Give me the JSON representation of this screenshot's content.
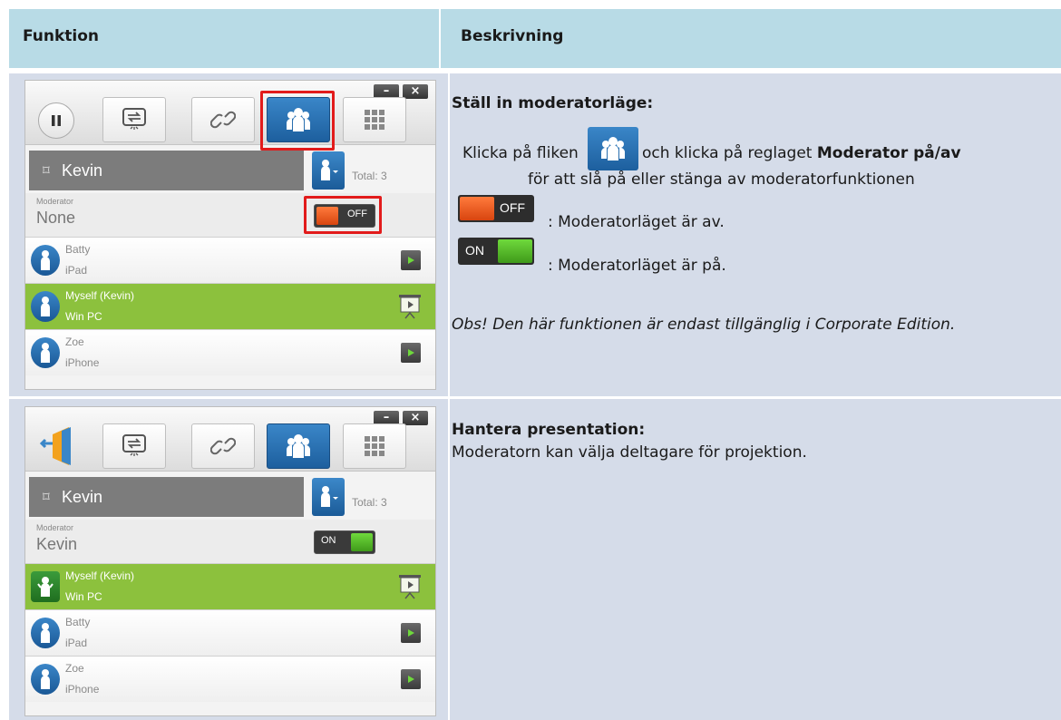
{
  "header": {
    "col1": "Funktion",
    "col2": "Beskrivning"
  },
  "row1": {
    "title": "Ställ in moderatorläge:",
    "line1_pre": "Klicka på fliken",
    "line1_mid": " och klicka på reglaget ",
    "line1_bold": "Moderator på/av",
    "line2": "för att slå på eller stänga av moderatorfunktionen",
    "off_desc": ": Moderatorläget är av.",
    "on_desc": ": Moderatorläget är på.",
    "note": "Obs! Den här funktionen är endast tillgänglig i Corporate Edition.",
    "panel": {
      "name": "Kevin",
      "total": "Total: 3",
      "moderator_label": "Moderator",
      "moderator_value": "None",
      "toggle_text": "OFF",
      "users": [
        {
          "name": "Batty",
          "device": "iPad"
        },
        {
          "name": "Myself (Kevin)",
          "device": "Win PC"
        },
        {
          "name": "Zoe",
          "device": "iPhone"
        }
      ]
    }
  },
  "row2": {
    "title": "Hantera presentation:",
    "text": "Moderatorn kan välja deltagare för projektion.",
    "panel": {
      "name": "Kevin",
      "total": "Total: 3",
      "moderator_label": "Moderator",
      "moderator_value": "Kevin",
      "toggle_text": "ON",
      "users": [
        {
          "name": "Myself (Kevin)",
          "device": "Win PC"
        },
        {
          "name": "Batty",
          "device": "iPad"
        },
        {
          "name": "Zoe",
          "device": "iPhone"
        }
      ]
    }
  },
  "toggle_labels": {
    "off": "OFF",
    "on": "ON"
  },
  "window_buttons": {
    "minimize": "–",
    "close": "×"
  },
  "colors": {
    "header_bg": "#b8dbe6",
    "row_bg": "#d5dce9",
    "accent_blue": "#1d5f9e",
    "green": "#8cc13d",
    "off_orange": "#e5521c",
    "highlight_red": "#e21b1b"
  }
}
